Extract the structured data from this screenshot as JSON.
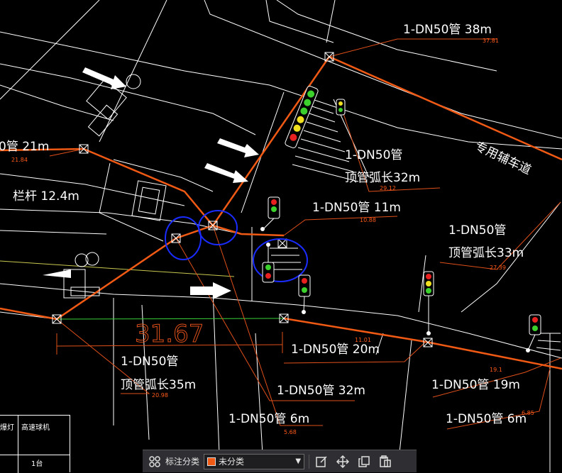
{
  "labels": {
    "l1": "1-DN50管 38m",
    "l2": "0管 21m",
    "l3": "1-DN50管",
    "l4": "顶管弧长32m",
    "l5": "栏杆 12.4m",
    "l6": "1-DN50管 11m",
    "l7": "1-DN50管",
    "l8": "顶管弧长33m",
    "l9": "1-DN50管 20m",
    "l10": "1-DN50管",
    "l11": "顶管弧长35m",
    "l12": "1-DN50管 32m",
    "l13": "1-DN50管 19m",
    "l14": "1-DN50管 6m",
    "l15": "1-DN50管 6m",
    "road_name": "专用辅车道"
  },
  "small_values": {
    "s1": "37.81",
    "s2": "21.84",
    "s3": "29.12",
    "s4": "10.88",
    "s5": "27.39",
    "s6": "19.1",
    "s7": "20.98",
    "s8": "5.68",
    "s9": "6.85",
    "s10": "11.01"
  },
  "dimension": "31.67",
  "table": {
    "h1": "爆灯",
    "h2": "高速球机",
    "v1": "1台"
  },
  "toolbar": {
    "label": "标注分类",
    "category_value": "未分类",
    "category_color": "#f05a14"
  },
  "colors": {
    "pipe": "#f05a14",
    "leader": "#e0501a",
    "circle": "#1a2cff",
    "line": "#ffffff"
  }
}
